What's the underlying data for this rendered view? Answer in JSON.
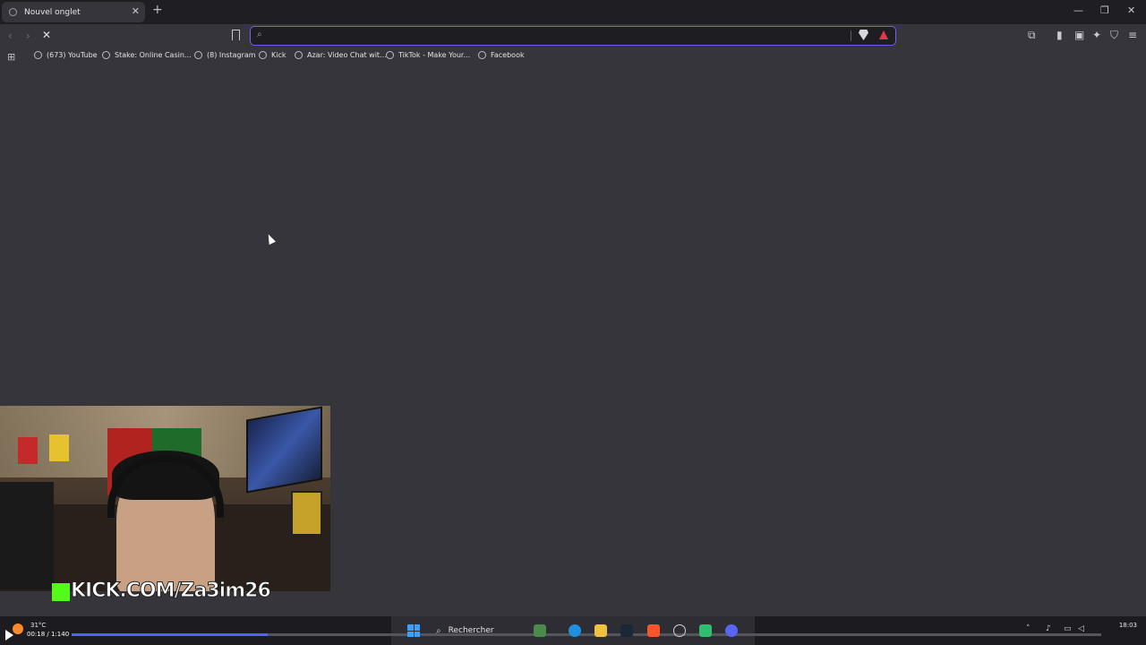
{
  "browser": {
    "tab": {
      "title": "Nouvel onglet",
      "close": "✕"
    },
    "new_tab": "+",
    "window_controls": {
      "minimize": "—",
      "restore": "❐",
      "close": "✕"
    },
    "nav": {
      "back": "‹",
      "forward": "›",
      "stop": "✕"
    },
    "address_bar": {
      "value": "",
      "placeholder": ""
    },
    "bookmarks": [
      {
        "label": "(673) YouTube"
      },
      {
        "label": "Stake: Online Casin..."
      },
      {
        "label": "(8) Instagram"
      },
      {
        "label": "Kick"
      },
      {
        "label": "Azar: Video Chat wit..."
      },
      {
        "label": "TikTok - Make Your..."
      },
      {
        "label": "Facebook"
      }
    ],
    "accent_color": "#7a5cf0"
  },
  "overlay": {
    "kick_text": "KICK.COM/Za3im26",
    "kick_color": "#53fc18"
  },
  "player": {
    "time": "00:18 / 1:140",
    "progress": 0.19
  },
  "taskbar": {
    "weather": "31°C",
    "search_label": "Rechercher",
    "clock_time": "18:03"
  }
}
